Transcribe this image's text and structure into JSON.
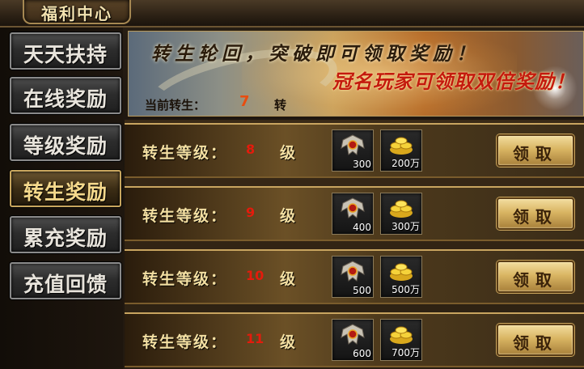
{
  "header": {
    "title": "福利中心"
  },
  "sidebar": {
    "items": [
      {
        "label": "天天扶持"
      },
      {
        "label": "在线奖励"
      },
      {
        "label": "等级奖励"
      },
      {
        "label": "转生奖励",
        "active": true
      },
      {
        "label": "累充奖励"
      },
      {
        "label": "充值回馈"
      }
    ]
  },
  "banner": {
    "line1": "转生轮回，突破即可领取奖励！",
    "line2": "冠名玩家可领取双倍奖励！",
    "current_label": "当前转生：",
    "current_value": "7",
    "current_unit": "转"
  },
  "rewards": [
    {
      "label": "转生等级：",
      "level": "8",
      "unit": "级",
      "item1_icon": "emblem-icon",
      "item1_count": "300",
      "item2_icon": "gold-ingots-icon",
      "item2_count": "200万",
      "claim": "领取"
    },
    {
      "label": "转生等级：",
      "level": "9",
      "unit": "级",
      "item1_icon": "emblem-icon",
      "item1_count": "400",
      "item2_icon": "gold-ingots-icon",
      "item2_count": "300万",
      "claim": "领取"
    },
    {
      "label": "转生等级：",
      "level": "10",
      "unit": "级",
      "item1_icon": "emblem-icon",
      "item1_count": "500",
      "item2_icon": "gold-ingots-icon",
      "item2_count": "500万",
      "claim": "领取"
    },
    {
      "label": "转生等级：",
      "level": "11",
      "unit": "级",
      "item1_icon": "emblem-icon",
      "item1_count": "600",
      "item2_icon": "gold-ingots-icon",
      "item2_count": "700万",
      "claim": "领取"
    }
  ],
  "colors": {
    "accent_gold": "#f3dfa2",
    "level_red": "#e41b0c",
    "banner_red": "#c41a0e"
  }
}
